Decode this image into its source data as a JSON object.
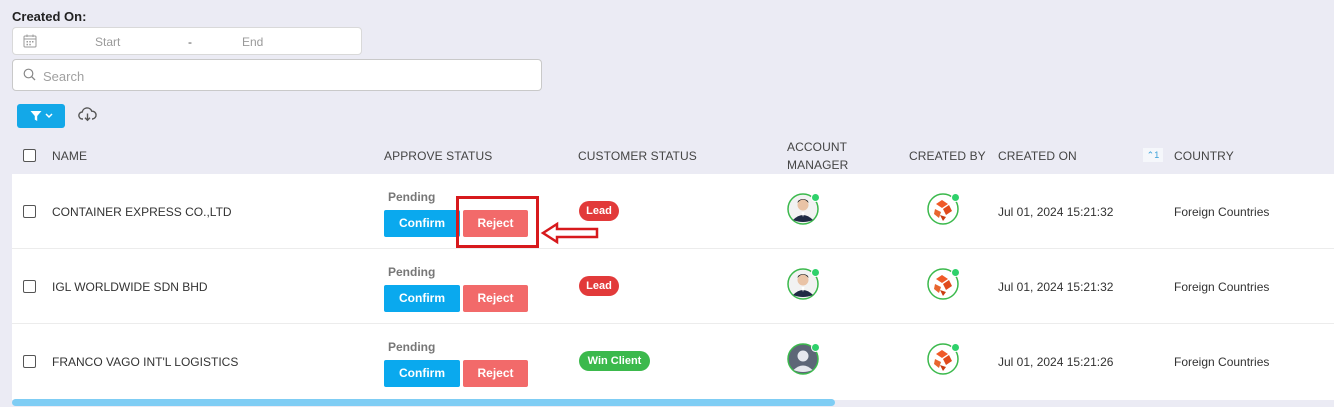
{
  "filters": {
    "created_on_label": "Created On:",
    "date_start_placeholder": "Start",
    "date_separator": "-",
    "date_end_placeholder": "End",
    "search_placeholder": "Search"
  },
  "table": {
    "headers": {
      "name": "NAME",
      "approve_status": "APPROVE STATUS",
      "customer_status": "CUSTOMER STATUS",
      "account_manager_line1": "ACCOUNT",
      "account_manager_line2": "MANAGER",
      "created_by": "CREATED BY",
      "created_on": "CREATED ON",
      "sort_indicator": "⌃1",
      "country": "COUNTRY"
    },
    "rows": [
      {
        "name": "CONTAINER EXPRESS CO.,LTD",
        "approve_status": "Pending",
        "confirm_label": "Confirm",
        "reject_label": "Reject",
        "customer_status": "Lead",
        "created_on": "Jul 01, 2024 15:21:32",
        "country": "Foreign Countries"
      },
      {
        "name": "IGL WORLDWIDE SDN BHD",
        "approve_status": "Pending",
        "confirm_label": "Confirm",
        "reject_label": "Reject",
        "customer_status": "Lead",
        "created_on": "Jul 01, 2024 15:21:32",
        "country": "Foreign Countries"
      },
      {
        "name": "FRANCO VAGO INT'L LOGISTICS",
        "approve_status": "Pending",
        "confirm_label": "Confirm",
        "reject_label": "Reject",
        "customer_status": "Win Client",
        "created_on": "Jul 01, 2024 15:21:26",
        "country": "Foreign Countries"
      }
    ]
  },
  "colors": {
    "background": "#ebebf4",
    "accent": "#13a8e8",
    "confirm": "#0aa9ee",
    "reject": "#f26a6a",
    "lead_badge": "#e23a3a",
    "win_client_badge": "#3bb94c",
    "online_dot": "#2fd16b",
    "highlight": "#d7191c"
  },
  "icons": [
    "calendar-icon",
    "search-icon",
    "filter-icon",
    "chevron-down-icon",
    "cloud-download-icon",
    "sort-ascending-icon",
    "avatar",
    "creator-logo-icon",
    "arrow-left-icon"
  ]
}
